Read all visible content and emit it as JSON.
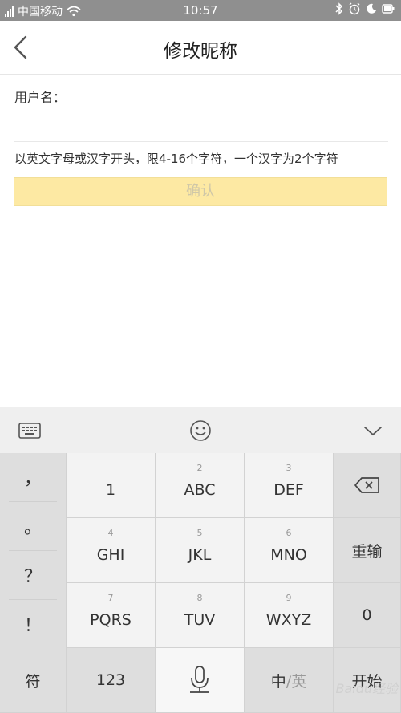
{
  "status_bar": {
    "carrier": "中国移动",
    "time": "10:57"
  },
  "header": {
    "title": "修改昵称",
    "back_icon": "chevron-left-icon"
  },
  "form": {
    "username_label": "用户名：",
    "username_value": "",
    "hint": "以英文字母或汉字开头，限4-16个字符，一个汉字为2个字符",
    "confirm_label": "确认"
  },
  "keyboard": {
    "toolbar": {
      "left_icon": "keyboard-icon",
      "center_icon": "emoji-icon",
      "right_icon": "chevron-down-icon"
    },
    "punctuation": [
      "，",
      "。",
      "？",
      "！"
    ],
    "keys": [
      {
        "num": "",
        "label": "1"
      },
      {
        "num": "2",
        "label": "ABC"
      },
      {
        "num": "3",
        "label": "DEF"
      },
      {
        "num": "4",
        "label": "GHI"
      },
      {
        "num": "5",
        "label": "JKL"
      },
      {
        "num": "6",
        "label": "MNO"
      },
      {
        "num": "7",
        "label": "PQRS"
      },
      {
        "num": "8",
        "label": "TUV"
      },
      {
        "num": "9",
        "label": "WXYZ"
      }
    ],
    "backspace_icon": "backspace-icon",
    "reenter_label": "重输",
    "zero_label": "0",
    "symbol_label": "符",
    "numeric_label": "123",
    "mic_icon": "microphone-icon",
    "lang_primary": "中",
    "lang_secondary": "/英",
    "start_label": "开始"
  },
  "watermark": "Baidu经验"
}
